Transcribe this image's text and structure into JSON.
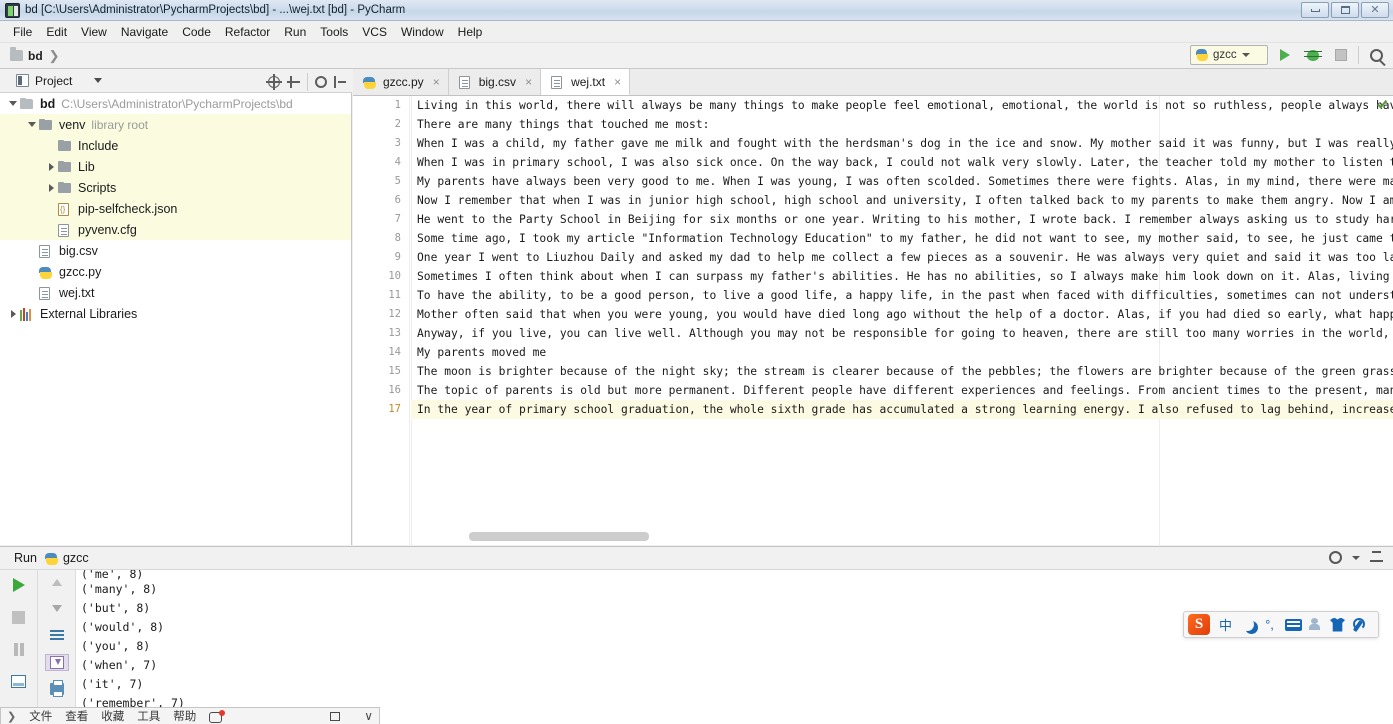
{
  "window": {
    "title": "bd [C:\\Users\\Administrator\\PycharmProjects\\bd] - ...\\wej.txt [bd] - PyCharm",
    "minimize_label": "Minimize",
    "maximize_label": "Maximize",
    "close_label": "Close"
  },
  "menubar": {
    "items": [
      {
        "label": "File"
      },
      {
        "label": "Edit"
      },
      {
        "label": "View"
      },
      {
        "label": "Navigate"
      },
      {
        "label": "Code"
      },
      {
        "label": "Refactor"
      },
      {
        "label": "Run"
      },
      {
        "label": "Tools"
      },
      {
        "label": "VCS"
      },
      {
        "label": "Window"
      },
      {
        "label": "Help"
      }
    ]
  },
  "navbar": {
    "breadcrumb": "bd",
    "run_config": "gzcc",
    "run_button": "Run",
    "debug_button": "Debug",
    "stop_button": "Stop",
    "search_button": "Search everywhere"
  },
  "project_tool": {
    "title": "Project",
    "actions": [
      "locate-in-tree",
      "collapse-all",
      "settings",
      "hide"
    ],
    "tree": [
      {
        "indent": 0,
        "arrow": "down",
        "icon": "folder",
        "name": "bd",
        "bold": true,
        "gray": "C:\\Users\\Administrator\\PycharmProjects\\bd",
        "highlight": false
      },
      {
        "indent": 1,
        "arrow": "down",
        "icon": "module",
        "name": "venv",
        "bold": false,
        "gray": "library root",
        "highlight": true
      },
      {
        "indent": 2,
        "arrow": "none",
        "icon": "module",
        "name": "Include",
        "bold": false,
        "gray": "",
        "highlight": true
      },
      {
        "indent": 2,
        "arrow": "right",
        "icon": "module",
        "name": "Lib",
        "bold": false,
        "gray": "",
        "highlight": true
      },
      {
        "indent": 2,
        "arrow": "right",
        "icon": "module",
        "name": "Scripts",
        "bold": false,
        "gray": "",
        "highlight": true
      },
      {
        "indent": 2,
        "arrow": "none",
        "icon": "json",
        "name": "pip-selfcheck.json",
        "bold": false,
        "gray": "",
        "highlight": true
      },
      {
        "indent": 2,
        "arrow": "none",
        "icon": "file",
        "name": "pyvenv.cfg",
        "bold": false,
        "gray": "",
        "highlight": true
      },
      {
        "indent": 1,
        "arrow": "none",
        "icon": "file",
        "name": "big.csv",
        "bold": false,
        "gray": "",
        "highlight": false
      },
      {
        "indent": 1,
        "arrow": "none",
        "icon": "py",
        "name": "gzcc.py",
        "bold": false,
        "gray": "",
        "highlight": false
      },
      {
        "indent": 1,
        "arrow": "none",
        "icon": "file",
        "name": "wej.txt",
        "bold": false,
        "gray": "",
        "highlight": false
      },
      {
        "indent": 0,
        "arrow": "right",
        "icon": "lib",
        "name": "External Libraries",
        "bold": false,
        "gray": "",
        "highlight": false
      }
    ]
  },
  "editor": {
    "tabs": [
      {
        "label": "gzcc.py",
        "icon": "py",
        "active": false,
        "close": "×"
      },
      {
        "label": "big.csv",
        "icon": "file",
        "active": false,
        "close": "×"
      },
      {
        "label": "wej.txt",
        "icon": "file",
        "active": true,
        "close": "×"
      }
    ],
    "current_line": 17,
    "inspection_status": "ok",
    "lines": [
      {
        "no": 1,
        "text": "Living in this world, there will always be many things to make people feel emotional, emotional, the world is not so ruthless, people always have feelings, people"
      },
      {
        "no": 2,
        "text": "There are many things that touched me most:"
      },
      {
        "no": 3,
        "text": "When I was a child, my father gave me milk and fought with the herdsman's dog in the ice and snow. My mother said it was funny, but I was really touched. This ofte"
      },
      {
        "no": 4,
        "text": "When I was in primary school, I was also sick once. On the way back, I could not walk very slowly. Later, the teacher told my mother to listen to me. My mother ca"
      },
      {
        "no": 5,
        "text": "My parents have always been very good to me. When I was young, I was often scolded. Sometimes there were fights. Alas, in my mind, there were many family rules at"
      },
      {
        "no": 6,
        "text": "Now I remember that when I was in junior high school, high school and university, I often talked back to my parents to make them angry. Now I am grown-ups. I often"
      },
      {
        "no": 7,
        "text": "He went to the Party School in Beijing for six months or one year. Writing to his mother, I wrote back. I remember always asking us to study hard, as if we were a"
      },
      {
        "no": 8,
        "text": "Some time ago, I took my article \"Information Technology Education\" to my father, he did not want to see, my mother said, to see, he just came to see presbyopic g"
      },
      {
        "no": 9,
        "text": "One year I went to Liuzhou Daily and asked my dad to help me collect a few pieces as a souvenir. He was always very quiet and said it was too late. Liuzhou Daily"
      },
      {
        "no": 10,
        "text": "Sometimes I often think about when I can surpass my father's abilities. He has no abilities, so I always make him look down on it. Alas, living in this kind of vi"
      },
      {
        "no": 11,
        "text": "To have the ability, to be a good person, to live a good life, a happy life, in the past when faced with difficulties, sometimes can not understand, but always th"
      },
      {
        "no": 12,
        "text": "Mother often said that when you were young, you would have died long ago without the help of a doctor. Alas, if you had died so early, what happiness would you ha"
      },
      {
        "no": 13,
        "text": "Anyway, if you live, you can live well. Although you may not be responsible for going to heaven, there are still too many worries in the world, so you can't walk"
      },
      {
        "no": 14,
        "text": "My parents moved me"
      },
      {
        "no": 15,
        "text": "The moon is brighter because of the night sky; the stream is clearer because of the pebbles; the flowers are brighter because of the green grass. Open the window"
      },
      {
        "no": 16,
        "text": "The topic of parents is old but more permanent. Different people have different experiences and feelings. From ancient times to the present, many literati and poe"
      },
      {
        "no": 17,
        "text": "In the year of primary school graduation, the whole sixth grade has accumulated a strong learning energy. I also refused to lag behind, increased horsepower, tigh"
      }
    ]
  },
  "run_panel": {
    "title": "Run",
    "config_name": "gzcc",
    "toolbar_left": [
      "rerun",
      "stop",
      "pause",
      "console",
      "pin"
    ],
    "toolbar_right": [
      "scroll-up",
      "scroll-down",
      "soft-wrap",
      "scroll-to-end",
      "print",
      "clear-all"
    ],
    "header_actions": [
      "settings",
      "hide"
    ],
    "output": [
      {
        "text": "('me', 8)",
        "clipped": true
      },
      {
        "text": "('many', 8)",
        "clipped": false
      },
      {
        "text": "('but', 8)",
        "clipped": false
      },
      {
        "text": "('would', 8)",
        "clipped": false
      },
      {
        "text": "('you', 8)",
        "clipped": false
      },
      {
        "text": "('when', 7)",
        "clipped": false
      },
      {
        "text": "('it', 7)",
        "clipped": false
      },
      {
        "text": "('remember', 7)",
        "clipped": false
      }
    ]
  },
  "ime": {
    "name": "Sogou",
    "logo": "S",
    "mode_label": "中",
    "items": [
      "logo",
      "chinese-mode",
      "moon",
      "punctuation",
      "soft-keyboard",
      "user",
      "skin",
      "toolbox"
    ],
    "punct_label": "°,"
  },
  "taskbar_window": {
    "menu": [
      "文件",
      "查看",
      "收藏",
      "工具",
      "帮助"
    ],
    "chevron": ")"
  },
  "colors": {
    "accent_green": "#4caf50",
    "highlight_yellow": "#fbfbe0",
    "current_line": "#fcfae2",
    "titlebar": "#cfdced",
    "ime_blue": "#1766b5",
    "ime_orange": "#e03d0b"
  }
}
